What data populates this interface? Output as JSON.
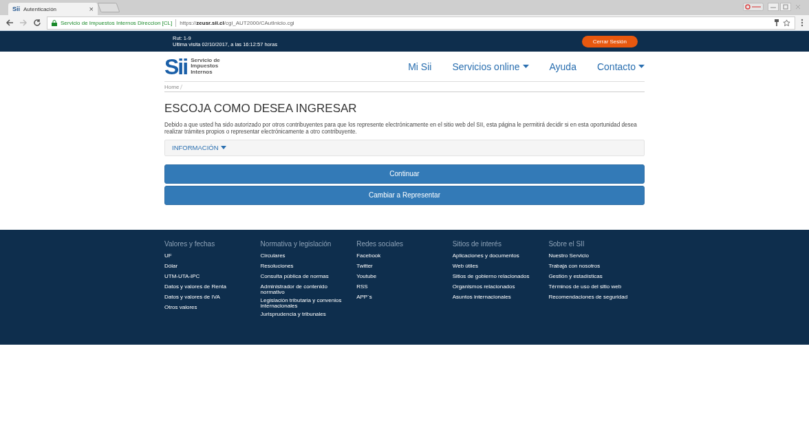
{
  "browser": {
    "tab": {
      "icon_text": "Sii",
      "title": "Autenticación",
      "close": "×"
    },
    "site_identity": "Servicio de Impuestos Internos Direccion [CL]",
    "url": "https://**zeusr.sii.cl**/cgi_AUT2000/CAutInicio.cgi"
  },
  "top_bar": {
    "rut": "Rut: 1-9",
    "last_visit": "Ultima visita 02/10/2017, a las 16:12:57 horas",
    "logout": "Cerrar Sesión"
  },
  "header": {
    "logo_mark": "Sii",
    "logo_text": [
      "Servicio de",
      "Impuestos",
      "Internos"
    ],
    "nav": [
      {
        "label": "Mi Sii",
        "dropdown": false
      },
      {
        "label": "Servicios online",
        "dropdown": true
      },
      {
        "label": "Ayuda",
        "dropdown": false
      },
      {
        "label": "Contacto",
        "dropdown": true
      }
    ]
  },
  "breadcrumb": [
    "Home"
  ],
  "title": "ESCOJA COMO DESEA INGRESAR",
  "description": "Debido a que usted ha sido autorizado por otros contribuyentes para que los represente electrónicamente en el sitio web del SII, esta página le permitirá decidir si en esta oportunidad desea realizar trámites propios o representar electrónicamente a otro contribuyente.",
  "info_panel": {
    "label": "INFORMACIÓN",
    "expanded": false
  },
  "buttons": [
    "Continuar",
    "Cambiar a Representar"
  ],
  "footer": [
    {
      "heading": "Valores y fechas",
      "links": [
        "UF",
        "Dólar",
        "UTM-UTA-IPC",
        "Datos y valores de Renta",
        "Datos y valores de IVA",
        "Otros valores"
      ]
    },
    {
      "heading": "Normativa y legislación",
      "links": [
        "Circulares",
        "Resoluciones",
        "Consulta pública de normas",
        "Administrador de contenido normativo",
        "Legislación tributaria y convenios internacionales",
        "Jurisprudencia y tribunales"
      ]
    },
    {
      "heading": "Redes sociales",
      "links": [
        "Facebook",
        "Twitter",
        "Youtube",
        "RSS",
        "APP´s"
      ]
    },
    {
      "heading": "Sitios de interés",
      "links": [
        "Aplicaciones y documentos",
        "Web útiles",
        "Sitios de gobierno relacionados",
        "Organismos relacionados",
        "Asuntos internacionales"
      ]
    },
    {
      "heading": "Sobre el SII",
      "links": [
        "Nuestro Servicio",
        "Trabaja con nosotros",
        "Gestión y estadísticas",
        "Términos de uso del sitio web",
        "Recomendaciones de seguridad"
      ]
    }
  ]
}
